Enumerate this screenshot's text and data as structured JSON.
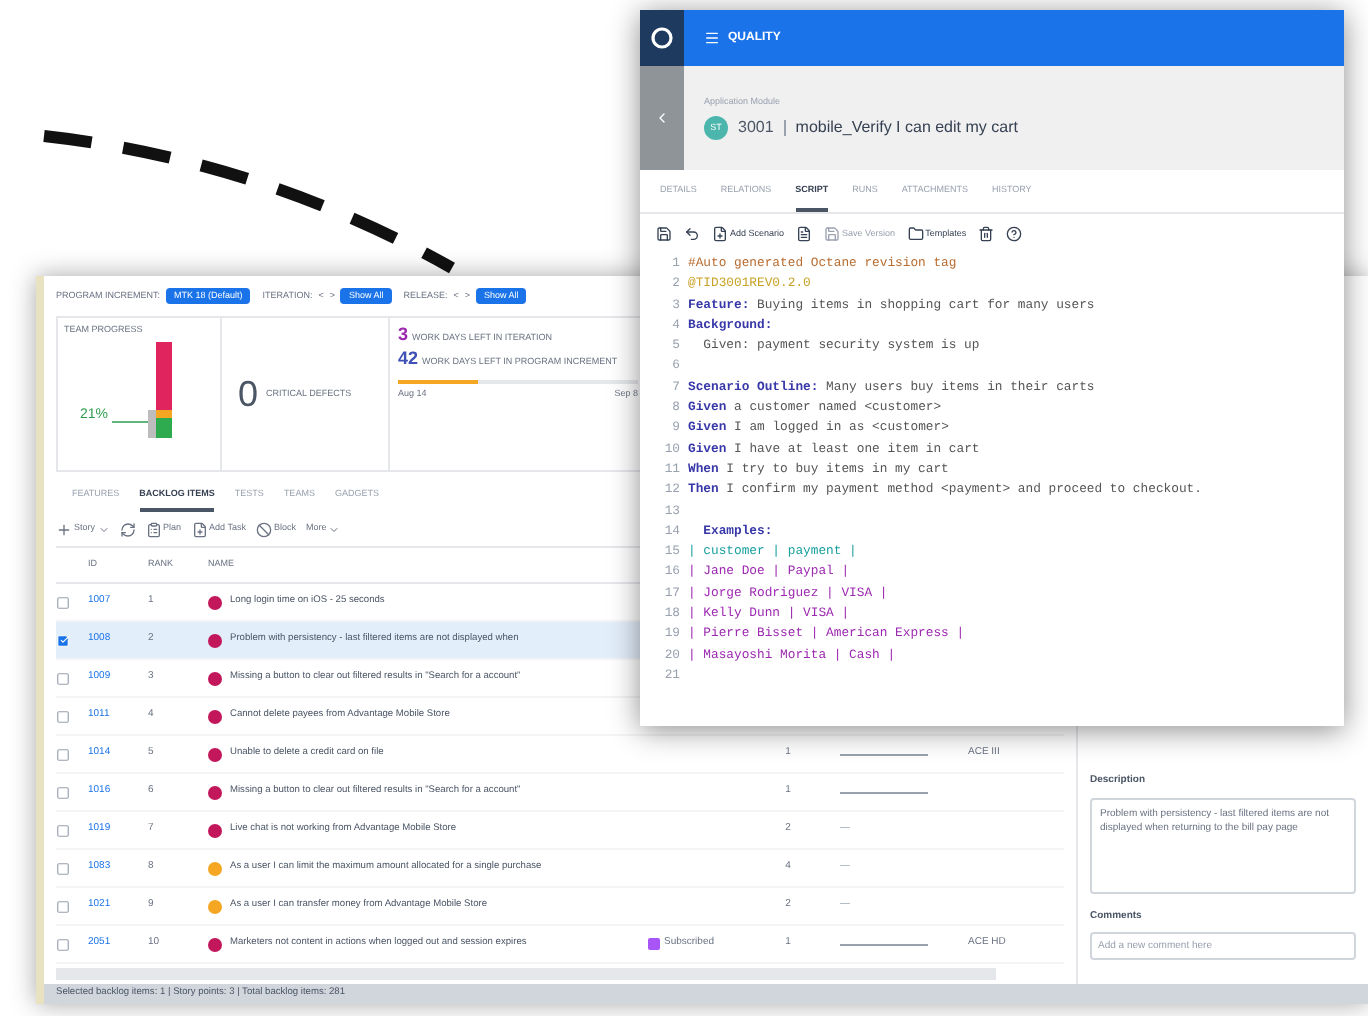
{
  "backlog_window": {
    "filters": [
      {
        "label": "PROGRAM INCREMENT:",
        "value": "MTK 18 (Default)"
      },
      {
        "label": "ITERATION:",
        "prev": "<",
        "next": ">",
        "value": "Show All"
      },
      {
        "label": "RELEASE:",
        "prev": "<",
        "next": ">",
        "value": "Show All"
      }
    ],
    "team_progress": {
      "title": "TEAM PROGRESS",
      "percent": "21%"
    },
    "critical_defects": {
      "count": "0",
      "label": "CRITICAL DEFECTS"
    },
    "days_left": [
      {
        "count": "3",
        "label": "WORK DAYS LEFT IN ITERATION",
        "color": "#9c27b0"
      },
      {
        "count": "42",
        "label": "WORK DAYS LEFT IN PROGRAM INCREMENT",
        "color": "#3f51b5"
      }
    ],
    "timeline": {
      "level": 0.33,
      "start": "Aug 14",
      "end": "Sep 8"
    },
    "tabs": [
      {
        "label": "FEATURES",
        "selected": false
      },
      {
        "label": "BACKLOG ITEMS",
        "selected": true
      },
      {
        "label": "TESTS",
        "selected": false
      },
      {
        "label": "TEAMS",
        "selected": false
      },
      {
        "label": "GADGETS",
        "selected": false
      }
    ],
    "toolbar": [
      {
        "kind": "add",
        "label": "Story"
      },
      {
        "kind": "refresh"
      },
      {
        "kind": "plan",
        "label": "Plan"
      },
      {
        "kind": "task",
        "label": "Add Task"
      },
      {
        "kind": "block",
        "label": "Block"
      },
      {
        "kind": "more",
        "label": "More"
      }
    ],
    "table": {
      "columns": [
        "ID",
        "RANK",
        "NAME"
      ],
      "rows": [
        {
          "id": "1007",
          "rank": "1",
          "name": "Long login time on iOS - 25 seconds",
          "color": "#c2185b",
          "checked": false,
          "selected": false
        },
        {
          "id": "1008",
          "rank": "2",
          "name": "Problem with persistency - last filtered items are not displayed when",
          "color": "#c2185b",
          "checked": true,
          "selected": true
        },
        {
          "id": "1009",
          "rank": "3",
          "name": "Missing a button to clear out filtered results in \"Search for a account\"",
          "color": "#c2185b",
          "checked": false,
          "selected": false
        },
        {
          "id": "1011",
          "rank": "4",
          "name": "Cannot delete payees from Advantage Mobile Store",
          "color": "#c2185b",
          "checked": false,
          "selected": false
        },
        {
          "id": "1014",
          "rank": "5",
          "name": "Unable to delete a credit card on file",
          "color": "#c2185b",
          "checked": false,
          "selected": false,
          "points": "1",
          "progress": {
            "level": 0
          },
          "release": "ACE III"
        },
        {
          "id": "1016",
          "rank": "6",
          "name": "Missing a button to clear out filtered results in \"Search for a account\"",
          "color": "#c2185b",
          "checked": false,
          "selected": false,
          "points": "1",
          "progress": {
            "level": 0
          }
        },
        {
          "id": "1019",
          "rank": "7",
          "name": "Live chat is not working from Advantage Mobile Store",
          "color": "#c2185b",
          "checked": false,
          "selected": false,
          "points": "2",
          "dash": "—"
        },
        {
          "id": "1083",
          "rank": "8",
          "name": "As a user I can limit the maximum amount allocated for a single purchase",
          "color": "#f5a623",
          "checked": false,
          "selected": false,
          "points": "4",
          "dash": "—"
        },
        {
          "id": "1021",
          "rank": "9",
          "name": "As a user I can transfer money from Advantage Mobile Store",
          "color": "#f5a623",
          "checked": false,
          "selected": false,
          "points": "2",
          "dash": "—"
        },
        {
          "id": "2051",
          "rank": "10",
          "name": "Marketers not content in actions when logged out and session expires",
          "color": "#c2185b",
          "checked": false,
          "selected": false,
          "tag": "Subscribed",
          "points": "1",
          "progress": {
            "level": 0
          },
          "release": "ACE HD"
        }
      ]
    },
    "details": {
      "description_label": "Description",
      "description": "Problem with persistency - last filtered items are not displayed when returning to the bill pay page",
      "comments_label": "Comments",
      "comment_placeholder": "Add a new comment here"
    },
    "status_bar": "Selected backlog items: 1 | Story points: 3 | Total backlog items: 281"
  },
  "script_window": {
    "app": "QUALITY",
    "breadcrumb": "Application Module",
    "avatar": "ST",
    "id": "3001",
    "name": "mobile_Verify I can edit my cart",
    "tabs": [
      {
        "label": "DETAILS",
        "selected": false
      },
      {
        "label": "RELATIONS",
        "selected": false
      },
      {
        "label": "SCRIPT",
        "selected": true
      },
      {
        "label": "RUNS",
        "selected": false
      },
      {
        "label": "ATTACHMENTS",
        "selected": false
      },
      {
        "label": "HISTORY",
        "selected": false
      }
    ],
    "toolbar": [
      {
        "kind": "save",
        "disabled": false
      },
      {
        "kind": "undo",
        "disabled": false
      },
      {
        "kind": "add-scenario",
        "label": "Add Scenario",
        "disabled": false
      },
      {
        "kind": "scenario",
        "disabled": false
      },
      {
        "kind": "save-version",
        "label": "Save Version",
        "disabled": true
      },
      {
        "kind": "templates",
        "label": "Templates",
        "disabled": false
      },
      {
        "kind": "delete",
        "disabled": false
      },
      {
        "kind": "help",
        "disabled": false
      }
    ],
    "lines": [
      {
        "number": "1",
        "segments": [
          {
            "kind": "comment",
            "text": "#Auto generated Octane revision tag"
          }
        ]
      },
      {
        "number": "2",
        "segments": [
          {
            "kind": "tag",
            "text": "@TID3001REV0.2.0"
          }
        ]
      },
      {
        "number": "3",
        "segments": [
          {
            "kind": "keyword",
            "text": "Feature:"
          },
          {
            "kind": "text",
            "text": " Buying items in shopping cart for many users"
          }
        ]
      },
      {
        "number": "4",
        "segments": [
          {
            "kind": "keyword",
            "text": "Background:"
          }
        ]
      },
      {
        "number": "5",
        "segments": [
          {
            "kind": "text",
            "text": "  Given: payment security system is up"
          }
        ]
      },
      {
        "number": "6"
      },
      {
        "number": "7",
        "segments": [
          {
            "kind": "keyword",
            "text": "Scenario Outline:"
          },
          {
            "kind": "text",
            "text": " Many users buy items in their carts"
          }
        ]
      },
      {
        "number": "8",
        "segments": [
          {
            "kind": "keyword",
            "text": "Given"
          },
          {
            "kind": "text",
            "text": " a customer named <customer>"
          }
        ]
      },
      {
        "number": "9",
        "segments": [
          {
            "kind": "keyword",
            "text": "Given"
          },
          {
            "kind": "text",
            "text": " I am logged in as <customer>"
          }
        ]
      },
      {
        "number": "10",
        "segments": [
          {
            "kind": "keyword",
            "text": "Given"
          },
          {
            "kind": "text",
            "text": " I have at least one item in cart"
          }
        ]
      },
      {
        "number": "11",
        "segments": [
          {
            "kind": "keyword",
            "text": "When"
          },
          {
            "kind": "text",
            "text": " I try to buy items in my cart"
          }
        ]
      },
      {
        "number": "12",
        "segments": [
          {
            "kind": "keyword",
            "text": "Then"
          },
          {
            "kind": "text",
            "text": " I confirm my payment method <payment> and proceed to checkout."
          }
        ]
      },
      {
        "number": "13"
      },
      {
        "number": "14",
        "segments": [
          {
            "kind": "keyword",
            "text": "  Examples:"
          }
        ]
      },
      {
        "number": "15",
        "segments": [
          {
            "kind": "table_header",
            "text": "| customer | payment |"
          }
        ]
      },
      {
        "number": "16",
        "segments": [
          {
            "kind": "table_cell",
            "text": "| Jane Doe | Paypal |"
          }
        ]
      },
      {
        "number": "17",
        "segments": [
          {
            "kind": "table_cell",
            "text": "| Jorge Rodriguez | VISA |"
          }
        ]
      },
      {
        "number": "18",
        "segments": [
          {
            "kind": "table_cell",
            "text": "| Kelly Dunn | VISA |"
          }
        ]
      },
      {
        "number": "19",
        "segments": [
          {
            "kind": "table_cell",
            "text": "| Pierre Bisset | American Express |"
          }
        ]
      },
      {
        "number": "20",
        "segments": [
          {
            "kind": "table_cell",
            "text": "| Masayoshi Morita | Cash |"
          }
        ]
      },
      {
        "number": "21"
      }
    ]
  }
}
